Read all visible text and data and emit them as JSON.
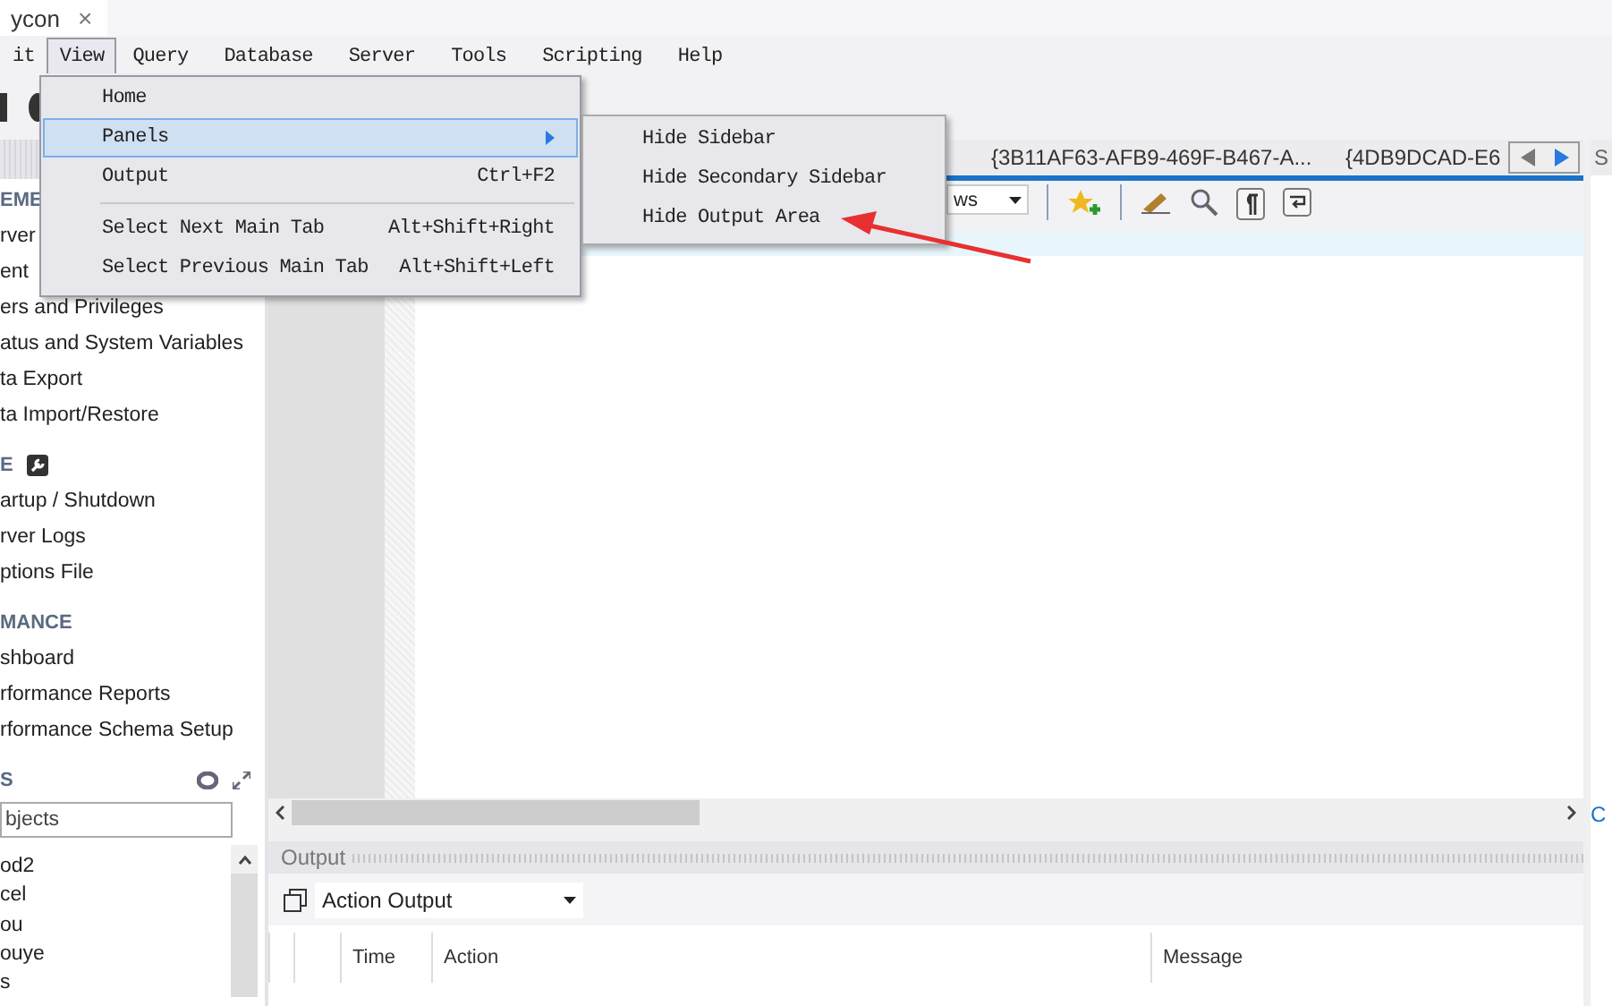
{
  "document_tab": {
    "title": "ycon",
    "close": "×"
  },
  "menu_bar": [
    {
      "label": "it",
      "selected": false
    },
    {
      "label": "View",
      "selected": true
    },
    {
      "label": "Query",
      "selected": false
    },
    {
      "label": "Database",
      "selected": false
    },
    {
      "label": "Server",
      "selected": false
    },
    {
      "label": "Tools",
      "selected": false
    },
    {
      "label": "Scripting",
      "selected": false
    },
    {
      "label": "Help",
      "selected": false
    }
  ],
  "view_menu": [
    {
      "kind": "item",
      "label": "Home",
      "selected": false
    },
    {
      "kind": "submenu",
      "label": "Panels",
      "selected": true
    },
    {
      "kind": "item",
      "label": "Output",
      "shortcut": "Ctrl+F2",
      "selected": false
    },
    {
      "kind": "separator"
    },
    {
      "kind": "item",
      "label": "Select Next Main Tab",
      "shortcut": "Alt+Shift+Right",
      "selected": false
    },
    {
      "kind": "item",
      "label": "Select Previous Main Tab",
      "shortcut": "Alt+Shift+Left",
      "selected": false
    }
  ],
  "panels_submenu": [
    "Hide Sidebar",
    "Hide Secondary Sidebar",
    "Hide Output Area"
  ],
  "sidebar": {
    "sections": [
      {
        "heading": "EME",
        "items": [
          "rver",
          "ent",
          "ers and Privileges",
          "atus and System Variables",
          "ta Export",
          "ta Import/Restore"
        ]
      },
      {
        "heading": "E",
        "tool_icon": true,
        "items": [
          "artup / Shutdown",
          "rver Logs",
          "ptions File"
        ]
      },
      {
        "heading": "MANCE",
        "items": [
          "shboard",
          "rformance Reports",
          "rformance Schema Setup"
        ]
      }
    ],
    "schemas": {
      "heading": "S",
      "search_value": "bjects",
      "tree": [
        "od2",
        "cel",
        "ou",
        "ouye",
        "s"
      ]
    }
  },
  "editor_tabs": [
    "{3B11AF63-AFB9-469F-B467-A...",
    "{4DB9DCAD-E6"
  ],
  "editor_toolbar": {
    "limit_select": "ws"
  },
  "secondary_sidebar": {
    "title": "S",
    "link": "C"
  },
  "output": {
    "title": "Output",
    "select": "Action Output",
    "columns": [
      "Time",
      "Action",
      "Message"
    ]
  }
}
